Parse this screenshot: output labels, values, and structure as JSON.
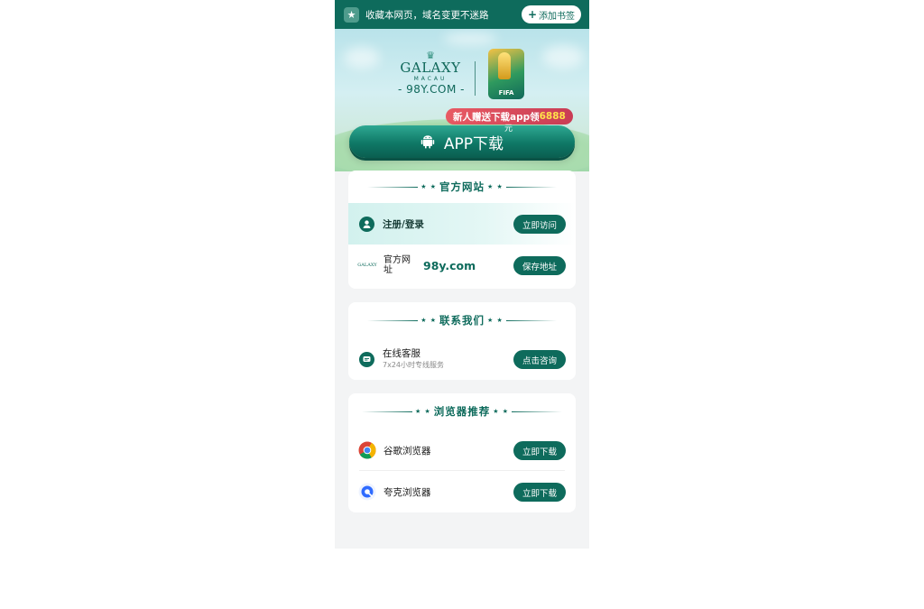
{
  "topbar": {
    "message": "收藏本网页，域名变更不迷路",
    "bookmark_button": "添加书签",
    "bookmark_plus": "+",
    "star_icon": "star-badge-icon"
  },
  "hero": {
    "logo_name": "GALAXY",
    "logo_sub": "MACAU",
    "logo_domain": "- 98Y.COM -",
    "partner_label": "FIFA",
    "promo_prefix": "新人赠送下载app领",
    "promo_amount": "6888",
    "promo_suffix": "元",
    "app_button": "APP下载"
  },
  "cards": {
    "official": {
      "title": "官方网站",
      "rows": [
        {
          "label": "注册/登录",
          "action": "立即访问",
          "icon": "user-icon"
        },
        {
          "label": "官方网址",
          "domain": "98y.com",
          "action": "保存地址",
          "icon": "galaxy-logo-icon"
        }
      ]
    },
    "contact": {
      "title": "联系我们",
      "rows": [
        {
          "label": "在线客服",
          "sublabel": "7x24小时专线服务",
          "action": "点击咨询",
          "icon": "chat-icon"
        }
      ]
    },
    "browsers": {
      "title": "浏览器推荐",
      "rows": [
        {
          "label": "谷歌浏览器",
          "action": "立即下载",
          "icon": "chrome-icon"
        },
        {
          "label": "夸克浏览器",
          "action": "立即下载",
          "icon": "quark-icon"
        }
      ]
    }
  },
  "colors": {
    "primary": "#0e6b5c",
    "promo": "#e0505c",
    "promo_highlight": "#ffe14a",
    "page_bg": "#f3f4f5"
  }
}
